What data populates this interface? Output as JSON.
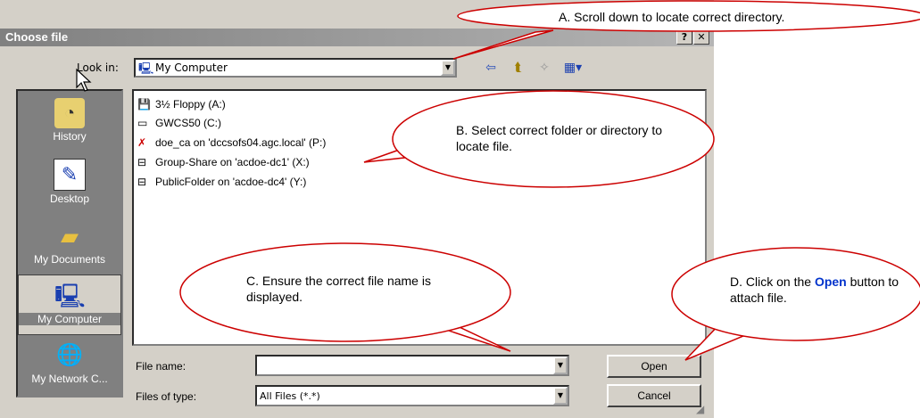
{
  "dialog": {
    "title": "Choose file",
    "lookin_label": "Look in:",
    "lookin_value": "My Computer",
    "places": [
      {
        "label": "History",
        "icon": "history-icon"
      },
      {
        "label": "Desktop",
        "icon": "desktop-icon"
      },
      {
        "label": "My Documents",
        "icon": "my-documents-icon"
      },
      {
        "label": "My Computer",
        "icon": "my-computer-icon"
      },
      {
        "label": "My Network C...",
        "icon": "network-icon"
      }
    ],
    "drives": [
      {
        "label": "3½ Floppy (A:)",
        "icon": "floppy-icon"
      },
      {
        "label": "GWCS50 (C:)",
        "icon": "hard-drive-icon"
      },
      {
        "label": "doe_ca on 'dccsofs04.agc.local' (P:)",
        "icon": "disconnected-drive-icon"
      },
      {
        "label": "Group-Share on 'acdoe-dc1' (X:)",
        "icon": "network-drive-icon"
      },
      {
        "label": "PublicFolder on 'acdoe-dc4' (Y:)",
        "icon": "network-drive-icon"
      }
    ],
    "filename_label": "File name:",
    "filename_value": "",
    "filetype_label": "Files of type:",
    "filetype_value": "All Files (*.*)",
    "open_label": "Open",
    "cancel_label": "Cancel"
  },
  "callouts": {
    "a": "A. Scroll down to locate correct directory.",
    "b": "B. Select correct folder or directory to locate file.",
    "c": "C. Ensure the correct file name is displayed.",
    "d_prefix": "D. Click on the ",
    "d_emph": "Open",
    "d_suffix": " button to attach file."
  },
  "colors": {
    "callout_stroke": "#cc0000",
    "emphasis": "#0033cc"
  }
}
